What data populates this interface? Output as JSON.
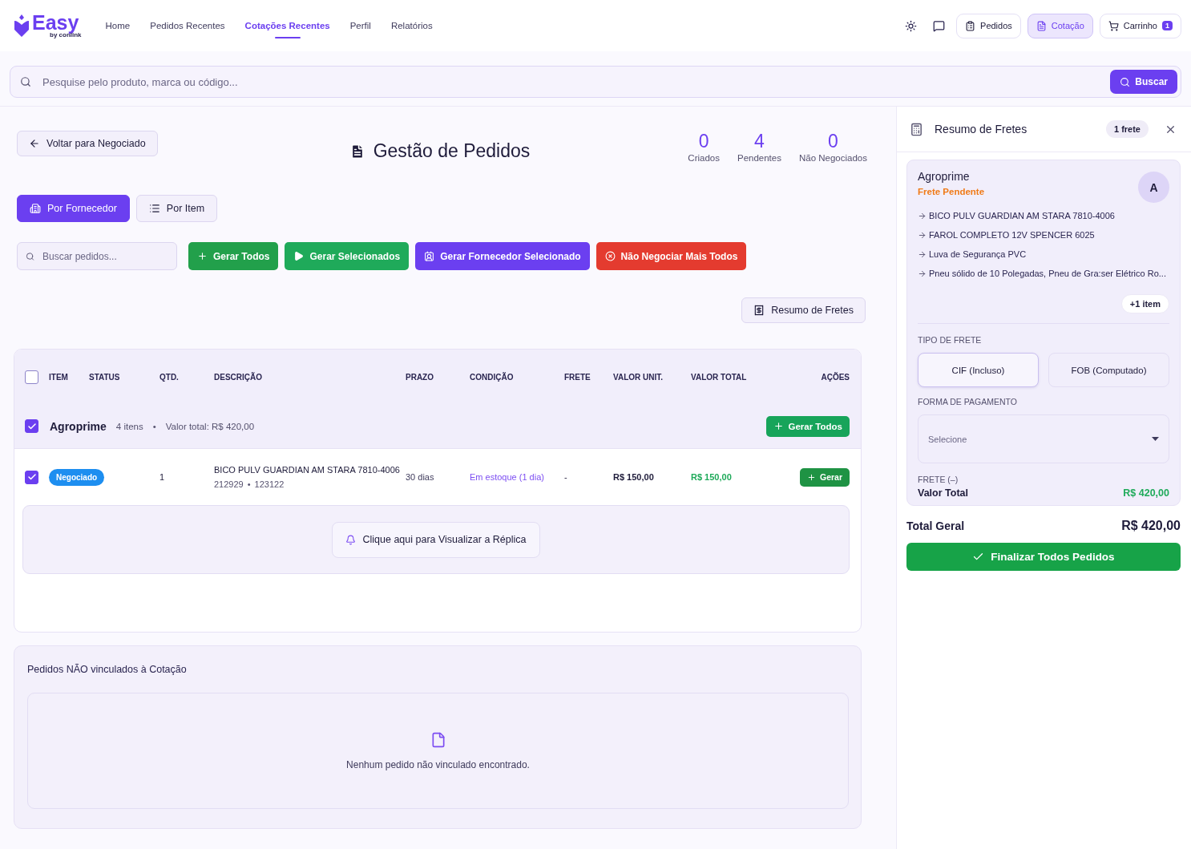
{
  "header": {
    "logo": {
      "word": "Easy",
      "tagline": "by conlink"
    },
    "nav": [
      {
        "label": "Home",
        "selected": false
      },
      {
        "label": "Pedidos Recentes",
        "selected": false
      },
      {
        "label": "Cotações Recentes",
        "selected": true
      },
      {
        "label": "Perfil",
        "selected": false
      },
      {
        "label": "Relatórios",
        "selected": false
      }
    ],
    "buttons": [
      {
        "kind": "orders",
        "label": "Pedidos",
        "selected": false
      },
      {
        "kind": "quote",
        "label": "Cotação",
        "selected": true
      },
      {
        "kind": "cart",
        "label": "Carrinho",
        "badge": "1",
        "selected": false
      }
    ]
  },
  "search": {
    "placeholder": "Pesquise pelo produto, marca ou código...",
    "button": "Buscar"
  },
  "page": {
    "back": "Voltar para Negociado",
    "title": "Gestão de Pedidos",
    "stats": [
      {
        "value": "0",
        "label": "Criados"
      },
      {
        "value": "4",
        "label": "Pendentes"
      },
      {
        "value": "0",
        "label": "Não Negociados"
      }
    ],
    "views": [
      {
        "kind": "supplier",
        "label": "Por Fornecedor",
        "selected": true
      },
      {
        "kind": "item",
        "label": "Por Item",
        "selected": false
      }
    ],
    "filter_placeholder": "Buscar pedidos...",
    "actions": [
      {
        "kind": "generate-all",
        "label": "Gerar Todos"
      },
      {
        "kind": "generate-selected",
        "label": "Gerar Selecionados"
      },
      {
        "kind": "generate-supplier",
        "label": "Gerar Fornecedor Selecionado"
      },
      {
        "kind": "reject-all",
        "label": "Não Negociar Mais Todos"
      }
    ],
    "freight_button": "Resumo de Fretes"
  },
  "table": {
    "all_checked": false,
    "columns": [
      "ITEM",
      "STATUS",
      "QTD.",
      "DESCRIÇÃO",
      "PRAZO",
      "CONDIÇÃO",
      "FRETE",
      "VALOR UNIT.",
      "VALOR TOTAL",
      "AÇÕES"
    ],
    "groups": [
      {
        "name": "Agroprime",
        "checked": true,
        "count": "4 itens",
        "separator": "•",
        "total": "Valor total: R$ 420,00",
        "button": "Gerar Todos",
        "rows": [
          {
            "checked": true,
            "status": "Negociado",
            "qty": "1",
            "description": "BICO PULV GUARDIAN AM STARA 7810-4006",
            "codes": [
              "212929",
              "123122"
            ],
            "code_separator": "•",
            "term": "30 dias",
            "condition": "Em estoque (1 dia)",
            "freight": "-",
            "unit_price": "R$ 150,00",
            "total_price": "R$ 150,00",
            "button": "Gerar"
          }
        ],
        "replica": "Clique aqui para Visualizar a Réplica"
      }
    ]
  },
  "unlinked": {
    "title": "Pedidos NÃO vinculados à Cotação",
    "empty": "Nenhum pedido não vinculado encontrado."
  },
  "freight_panel": {
    "title": "Resumo de Fretes",
    "badge": "1 frete",
    "suppliers": [
      {
        "name": "Agroprime",
        "status": "Frete Pendente",
        "avatar": "A",
        "items": [
          "BICO PULV GUARDIAN AM STARA 7810-4006",
          "FAROL COMPLETO 12V SPENCER 6025",
          "Luva de Segurança PVC",
          "Pneu sólido de 10 Polegadas, Pneu de Gra:ser Elétrico Ro..."
        ],
        "more": "+1 item",
        "freight_label": "TIPO DE FRETE",
        "freight_options": [
          {
            "label": "CIF (Incluso)",
            "selected": true
          },
          {
            "label": "FOB (Computado)",
            "selected": false
          }
        ],
        "payment_label": "FORMA DE PAGAMENTO",
        "payment_placeholder": "Selecione",
        "freight_value": "FRETE (–)",
        "total_label": "Valor Total",
        "total": "R$ 420,00"
      }
    ],
    "grand_label": "Total Geral",
    "grand_total": "R$ 420,00",
    "finish": "Finalizar Todos Pedidos"
  }
}
